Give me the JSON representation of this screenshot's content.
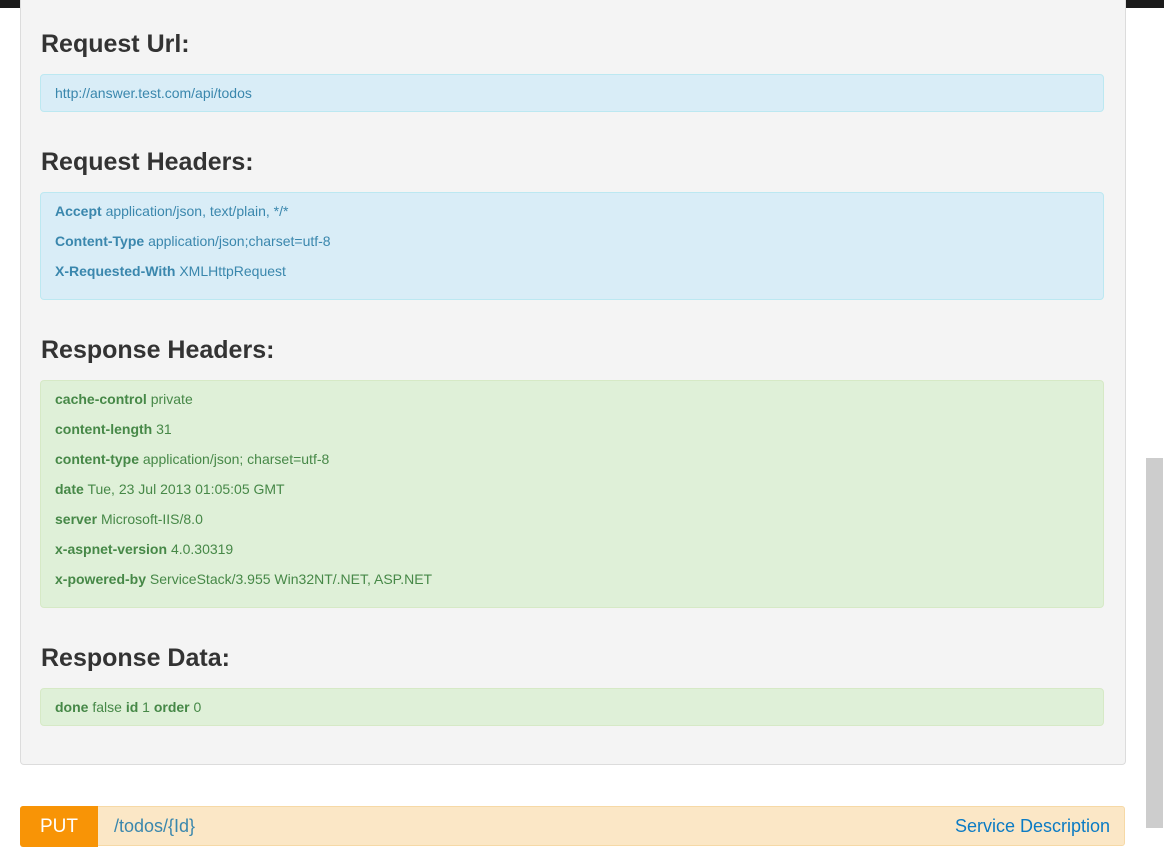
{
  "request_url": {
    "title": "Request Url:",
    "value": "http://answer.test.com/api/todos"
  },
  "request_headers": {
    "title": "Request Headers:",
    "items": [
      {
        "key": "Accept",
        "value": "application/json, text/plain, */*"
      },
      {
        "key": "Content-Type",
        "value": "application/json;charset=utf-8"
      },
      {
        "key": "X-Requested-With",
        "value": "XMLHttpRequest"
      }
    ]
  },
  "response_headers": {
    "title": "Response Headers:",
    "items": [
      {
        "key": "cache-control",
        "value": "private"
      },
      {
        "key": "content-length",
        "value": "31"
      },
      {
        "key": "content-type",
        "value": "application/json; charset=utf-8"
      },
      {
        "key": "date",
        "value": "Tue, 23 Jul 2013 01:05:05 GMT"
      },
      {
        "key": "server",
        "value": "Microsoft-IIS/8.0"
      },
      {
        "key": "x-aspnet-version",
        "value": "4.0.30319"
      },
      {
        "key": "x-powered-by",
        "value": "ServiceStack/3.955 Win32NT/.NET, ASP.NET"
      }
    ]
  },
  "response_data": {
    "title": "Response Data:",
    "items": [
      {
        "key": "done",
        "value": "false"
      },
      {
        "key": "id",
        "value": "1"
      },
      {
        "key": "order",
        "value": "0"
      }
    ]
  },
  "endpoint": {
    "method": "PUT",
    "path": "/todos/{Id}",
    "service_link": "Service Description"
  },
  "colors": {
    "info_bg": "#d9edf7",
    "info_text": "#3a87ad",
    "success_bg": "#dff0d8",
    "success_text": "#468847",
    "put_method_bg": "#f89406",
    "put_bar_bg": "#fbe7c6"
  }
}
